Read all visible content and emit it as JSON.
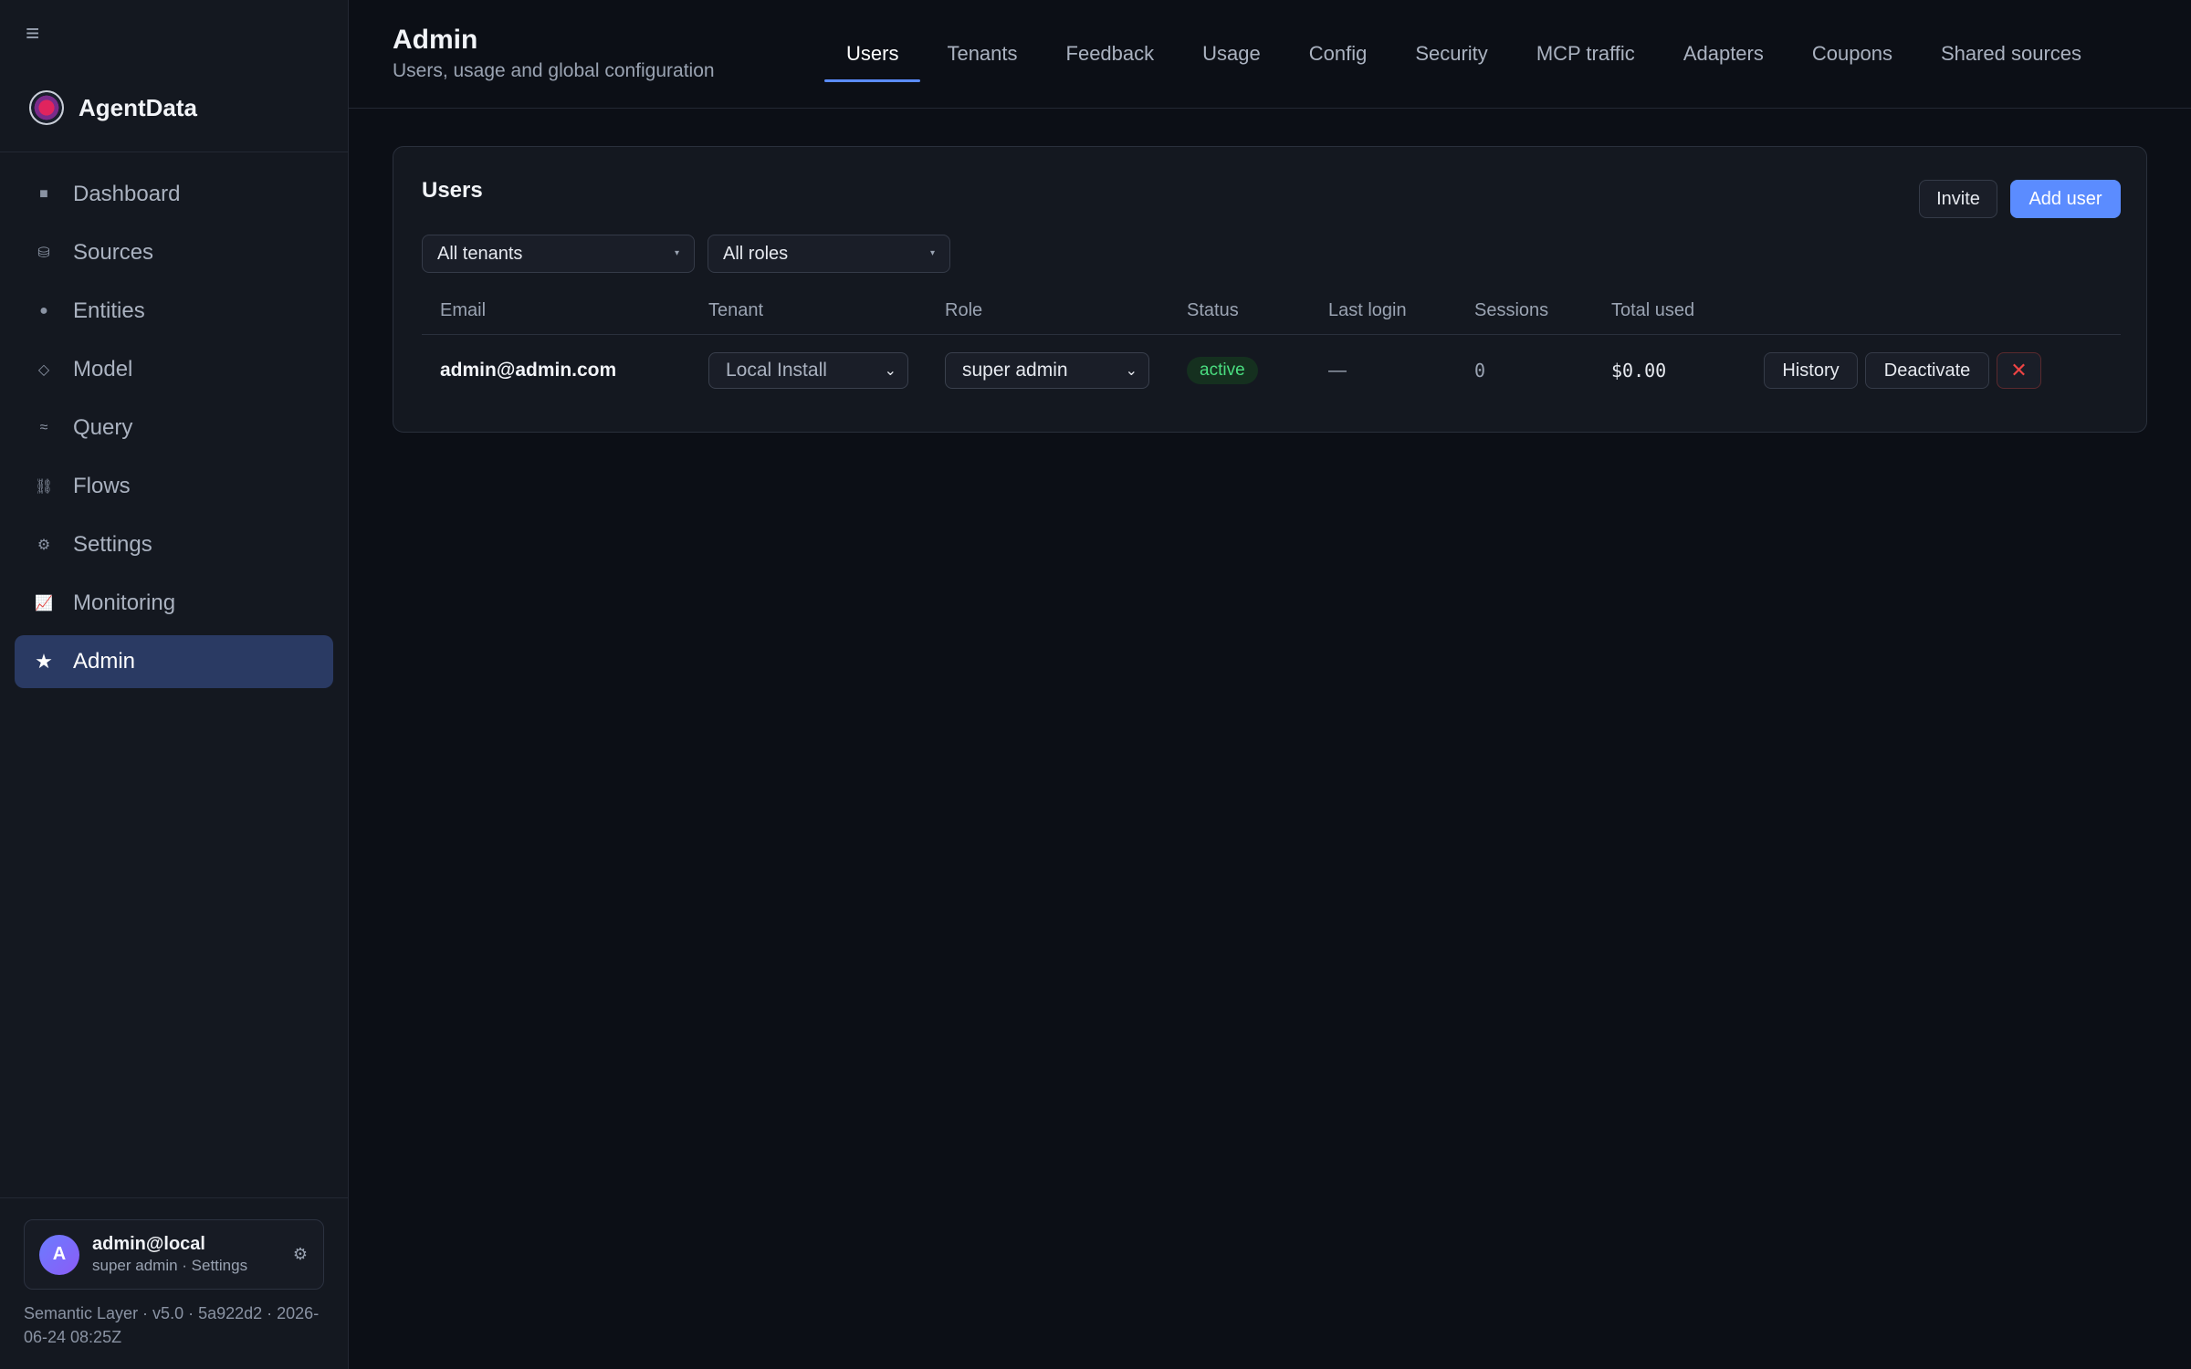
{
  "sidebar": {
    "brand": "AgentData",
    "items": [
      {
        "label": "Dashboard",
        "icon": "■"
      },
      {
        "label": "Sources",
        "icon": "⛁"
      },
      {
        "label": "Entities",
        "icon": "●"
      },
      {
        "label": "Model",
        "icon": "◇"
      },
      {
        "label": "Query",
        "icon": "≈"
      },
      {
        "label": "Flows",
        "icon": "⛓"
      },
      {
        "label": "Settings",
        "icon": "⚙"
      },
      {
        "label": "Monitoring",
        "icon": "📈"
      },
      {
        "label": "Admin",
        "icon": "★"
      }
    ],
    "active_item": "Admin",
    "user": {
      "avatar": "A",
      "name": "admin@local",
      "sub": "super admin · Settings"
    },
    "footer": "Semantic Layer · v5.0 · 5a922d2 · 2026-06-24 08:25Z"
  },
  "header": {
    "title": "Admin",
    "subtitle": "Users, usage and global configuration",
    "tabs": [
      "Users",
      "Tenants",
      "Feedback",
      "Usage",
      "Config",
      "Security",
      "MCP traffic",
      "Adapters",
      "Coupons",
      "Shared sources"
    ],
    "active_tab": "Users"
  },
  "panel": {
    "title": "Users",
    "invite_label": "Invite",
    "add_user_label": "Add user",
    "filter_tenants": "All tenants",
    "filter_roles": "All roles",
    "columns": [
      "Email",
      "Tenant",
      "Role",
      "Status",
      "Last login",
      "Sessions",
      "Total used"
    ],
    "rows": [
      {
        "email": "admin@admin.com",
        "tenant": "Local Install",
        "role": "super admin",
        "status": "active",
        "last_login": "—",
        "sessions": "0",
        "total_used": "$0.00",
        "history_label": "History",
        "deactivate_label": "Deactivate",
        "delete_label": "✕"
      }
    ]
  },
  "colors": {
    "accent": "#5b8cff",
    "active_nav": "#2a3a63",
    "status_active": "#4ade80",
    "danger": "#ef4444"
  }
}
